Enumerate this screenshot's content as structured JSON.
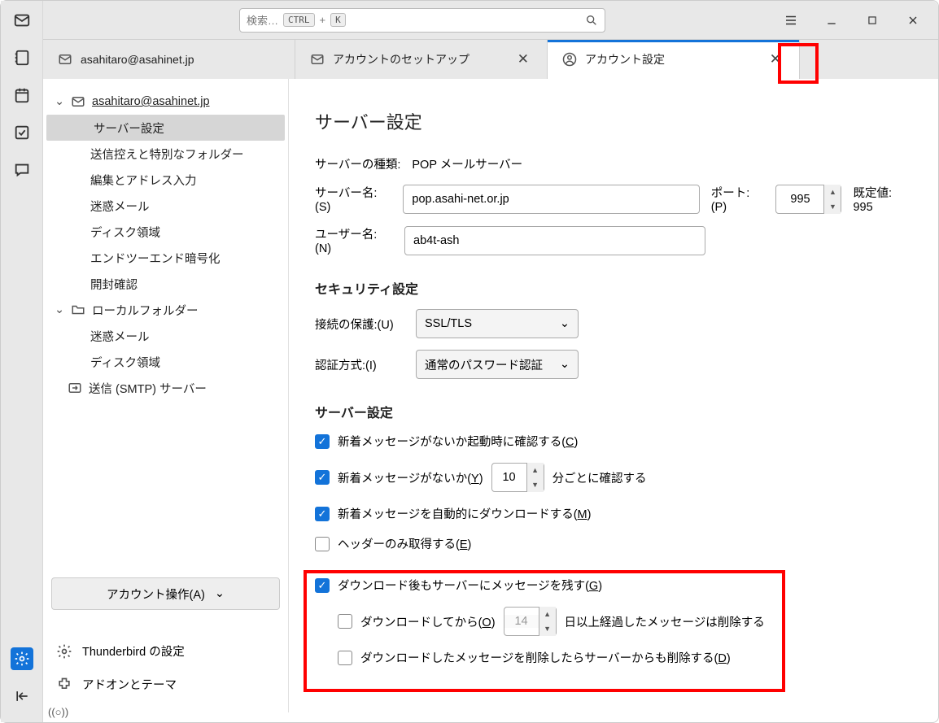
{
  "search": {
    "placeholder": "検索…",
    "kbd1": "CTRL",
    "plus": "+",
    "kbd2": "K"
  },
  "tabs": [
    {
      "label": "asahitaro@asahinet.jp"
    },
    {
      "label": "アカウントのセットアップ"
    },
    {
      "label": "アカウント設定"
    }
  ],
  "sidebar": {
    "account": "asahitaro@asahinet.jp",
    "items": [
      "サーバー設定",
      "送信控えと特別なフォルダー",
      "編集とアドレス入力",
      "迷惑メール",
      "ディスク領域",
      "エンドツーエンド暗号化",
      "開封確認"
    ],
    "local": "ローカルフォルダー",
    "local_items": [
      "迷惑メール",
      "ディスク領域"
    ],
    "smtp": "送信 (SMTP) サーバー",
    "ops": "アカウント操作(A)",
    "tb_settings": "Thunderbird の設定",
    "addons": "アドオンとテーマ"
  },
  "content": {
    "title": "サーバー設定",
    "server_type_lbl": "サーバーの種類:",
    "server_type_val": "POP メールサーバー",
    "server_name_lbl": "サーバー名:(S)",
    "server_name_val": "pop.asahi-net.or.jp",
    "port_lbl": "ポート:(P)",
    "port_val": "995",
    "default_lbl": "既定値: 995",
    "user_lbl": "ユーザー名:(N)",
    "user_val": "ab4t-ash",
    "sec_title": "セキュリティ設定",
    "conn_lbl": "接続の保護:(U)",
    "conn_val": "SSL/TLS",
    "auth_lbl": "認証方式:(I)",
    "auth_val": "通常のパスワード認証",
    "srv_title": "サーバー設定",
    "c1a": "新着メッセージがないか起動時に確認する(",
    "c1b": "C",
    "c1c": ")",
    "c2a": "新着メッセージがないか(",
    "c2b": "Y",
    "c2c": ")",
    "c2d": "分ごとに確認する",
    "c2_val": "10",
    "c3a": "新着メッセージを自動的にダウンロードする(",
    "c3b": "M",
    "c3c": ")",
    "c4a": "ヘッダーのみ取得する(",
    "c4b": "E",
    "c4c": ")",
    "c5a": "ダウンロード後もサーバーにメッセージを残す(",
    "c5b": "G",
    "c5c": ")",
    "c6a": "ダウンロードしてから(",
    "c6b": "O",
    "c6c": ")",
    "c6d": "日以上経過したメッセージは削除する",
    "c6_val": "14",
    "c7a": "ダウンロードしたメッセージを削除したらサーバーからも削除する(",
    "c7b": "D",
    "c7c": ")"
  },
  "status": "((○))"
}
